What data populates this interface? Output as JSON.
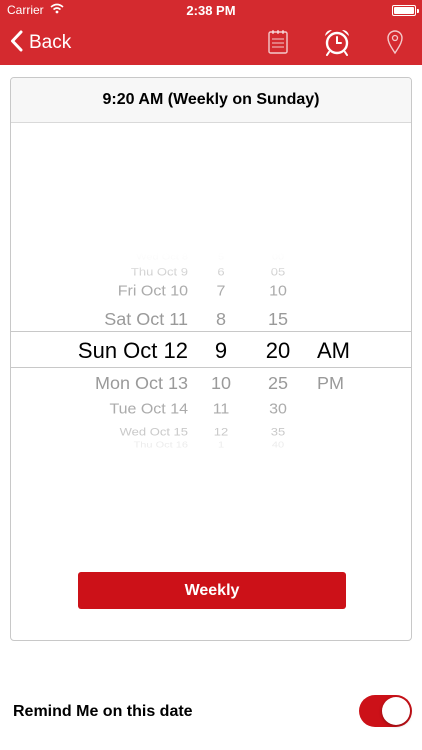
{
  "status": {
    "carrier": "Carrier",
    "time": "2:38 PM"
  },
  "nav": {
    "back_label": "Back",
    "icons": [
      "notes-icon",
      "alarm-clock-icon",
      "location-pin-icon"
    ]
  },
  "colors": {
    "header": "#d42a2f",
    "accent": "#cc1118"
  },
  "card": {
    "title": "9:20 AM (Weekly on Sunday)"
  },
  "picker": {
    "dates": [
      "Wed Oct 8",
      "Thu Oct 9",
      "Fri Oct 10",
      "Sat Oct 11",
      "Sun Oct 12",
      "Mon Oct 13",
      "Tue Oct 14",
      "Wed Oct 15",
      "Thu Oct 16"
    ],
    "hours": [
      "5",
      "6",
      "7",
      "8",
      "9",
      "10",
      "11",
      "12",
      "1"
    ],
    "minutes": [
      "00",
      "05",
      "10",
      "15",
      "20",
      "25",
      "30",
      "35",
      "40"
    ],
    "ampm": [
      "AM",
      "PM"
    ],
    "selected": {
      "date": "Sun Oct 12",
      "hour": "9",
      "minute": "20",
      "ampm": "AM"
    }
  },
  "buttons": {
    "weekly": "Weekly"
  },
  "remind": {
    "label": "Remind Me on this date",
    "enabled": true
  }
}
